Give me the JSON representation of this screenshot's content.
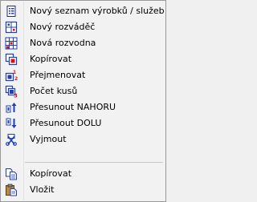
{
  "menu": {
    "items": [
      {
        "label": "Nový seznam výrobků / služeb",
        "icon": "new-list-icon"
      },
      {
        "label": "Nový rozváděč",
        "icon": "new-switchboard-icon"
      },
      {
        "label": "Nová rozvodna",
        "icon": "new-substation-icon"
      },
      {
        "label": "Kopírovat",
        "icon": "copy-item-icon"
      },
      {
        "label": "Přejmenovat",
        "icon": "rename-icon"
      },
      {
        "label": "Počet kusů",
        "icon": "quantity-icon"
      },
      {
        "label": "Přesunout NAHORU",
        "icon": "move-up-icon"
      },
      {
        "label": "Přesunout DOLU",
        "icon": "move-down-icon"
      },
      {
        "label": "Vyjmout",
        "icon": "cut-icon"
      }
    ],
    "clipboard_items": [
      {
        "label": "Kopírovat",
        "icon": "copy-icon"
      },
      {
        "label": "Vložit",
        "icon": "paste-icon"
      }
    ]
  },
  "colors": {
    "accent_blue": "#1f3fb8",
    "accent_red": "#d01818",
    "background": "#f2f2f2"
  }
}
